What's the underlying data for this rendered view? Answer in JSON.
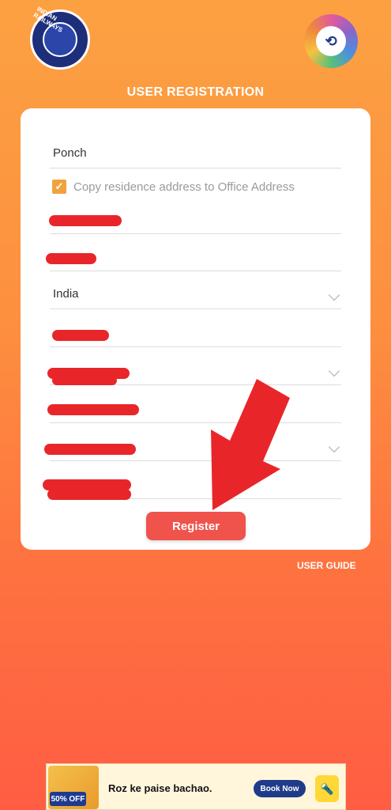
{
  "header": {
    "left_logo_text": "INDIAN RAILWAYS",
    "right_logo_glyph": "⟲",
    "title": "USER REGISTRATION"
  },
  "form": {
    "field_1_value": "Ponch",
    "copy_address_label": "Copy residence address to Office Address",
    "copy_address_checked": true,
    "checkbox_glyph": "✓",
    "country_value": "India",
    "register_label": "Register"
  },
  "footer": {
    "user_guide_label": "USER GUIDE"
  },
  "ad": {
    "discount": "50% OFF",
    "tagline": "Roz ke paise bachao.",
    "cta": "Book Now",
    "app_icon": "🔦"
  },
  "colors": {
    "accent": "#f0524c",
    "arrow": "#e8262a",
    "checkbox": "#f1a23f"
  }
}
